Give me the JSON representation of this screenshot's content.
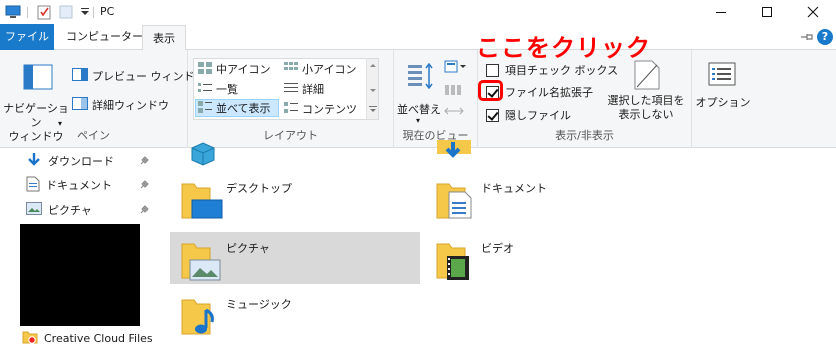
{
  "window": {
    "title": "PC",
    "minimize": "—",
    "maximize": "☐",
    "close": "✕"
  },
  "tabs": {
    "file": "ファイル",
    "computer": "コンピューター",
    "view": "表示"
  },
  "ribbon": {
    "panes": {
      "nav_pane": "ナビゲーション\nウィンドウ",
      "preview": "プレビュー ウィンドウ",
      "details": "詳細ウィンドウ",
      "label": "ペイン"
    },
    "layout": {
      "extra_large": "中アイコン",
      "small": "小アイコン",
      "list": "一覧",
      "details": "詳細",
      "tiles": "並べて表示",
      "content": "コンテンツ",
      "label": "レイアウト"
    },
    "current_view": {
      "sort": "並べ替え",
      "label": "現在のビュー"
    },
    "show_hide": {
      "item_checkboxes": "項目チェック ボックス",
      "file_extensions": "ファイル名拡張子",
      "hidden_items": "隠しファイル",
      "hide_selected": "選択した項目を\n表示しない",
      "label": "表示/非表示"
    },
    "options": "オプション"
  },
  "annotation": {
    "text": "ここをクリック",
    "color": "#ff0000"
  },
  "nav": {
    "items": [
      "ダウンロード",
      "ドキュメント",
      "ピクチャ"
    ],
    "bottom_item": "Creative Cloud Files"
  },
  "content": {
    "folders": [
      {
        "label": ""
      },
      {
        "label": ""
      },
      {
        "label": "デスクトップ"
      },
      {
        "label": "ドキュメント"
      },
      {
        "label": "ピクチャ"
      },
      {
        "label": "ビデオ"
      },
      {
        "label": "ミュージック"
      }
    ]
  },
  "colors": {
    "accent": "#1979ca",
    "ribbon_bg": "#f5f6f7",
    "selection": "#cce8ff",
    "folder_selected": "#d9d9d9"
  }
}
